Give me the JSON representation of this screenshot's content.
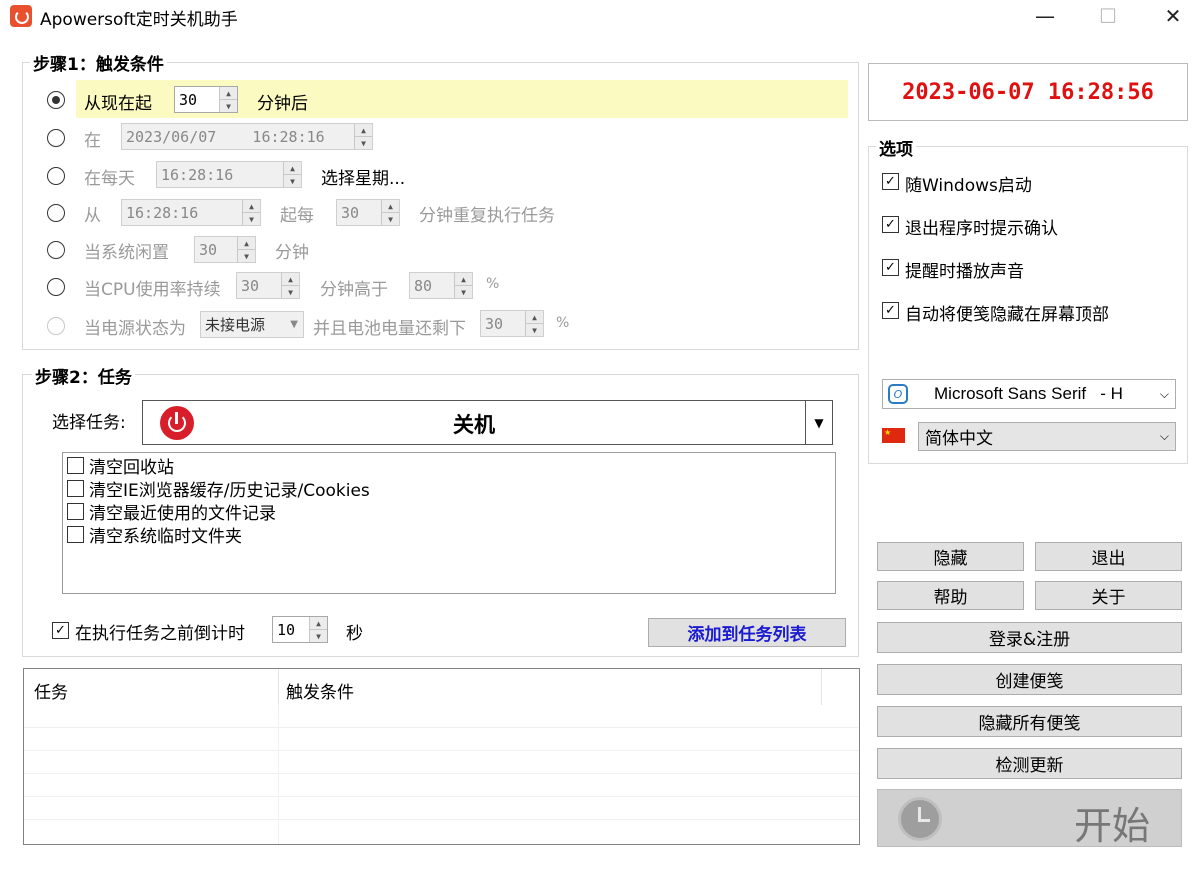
{
  "window": {
    "title": "Apowersoft定时关机助手",
    "minimize": "—",
    "maximize": "☐",
    "close": "✕"
  },
  "step1": {
    "label": "步骤1：触发条件",
    "rows": [
      {
        "label": "从现在起",
        "value": "30",
        "suffix": "分钟后",
        "selected": true
      },
      {
        "label": "在",
        "datetime": "2023/06/07    16:28:16"
      },
      {
        "label": "在每天",
        "time": "16:28:16",
        "suffix": "选择星期..."
      },
      {
        "label": "从",
        "time": "16:28:16",
        "mid": "起每",
        "value": "30",
        "suffix": "分钟重复执行任务"
      },
      {
        "label": "当系统闲置",
        "value": "30",
        "suffix": "分钟"
      },
      {
        "label": "当CPU使用率持续",
        "value": "30",
        "mid": "分钟高于",
        "value2": "80",
        "suffix": "%"
      },
      {
        "label": "当电源状态为",
        "select": "未接电源",
        "mid": "并且电池电量还剩下",
        "value": "30",
        "suffix": "%"
      }
    ]
  },
  "step2": {
    "label": "步骤2：任务",
    "select_label": "选择任务:",
    "task": "关机",
    "options": [
      "清空回收站",
      "清空IE浏览器缓存/历史记录/Cookies",
      "清空最近使用的文件记录",
      "清空系统临时文件夹"
    ],
    "countdown_label": "在执行任务之前倒计时",
    "countdown_value": "10",
    "countdown_unit": "秒",
    "add_button": "添加到任务列表"
  },
  "task_table": {
    "columns": [
      "任务",
      "触发条件"
    ]
  },
  "clock": "2023-06-07  16:28:56",
  "options": {
    "label": "选项",
    "checks": [
      "随Windows启动",
      "退出程序时提示确认",
      "提醒时播放声音",
      "自动将便笺隐藏在屏幕顶部"
    ],
    "font": "Microsoft Sans Serif   - H",
    "language": "简体中文"
  },
  "buttons": {
    "hide": "隐藏",
    "exit": "退出",
    "help": "帮助",
    "about": "关于",
    "login": "登录&注册",
    "create_note": "创建便笺",
    "hide_notes": "隐藏所有便笺",
    "update": "检测更新",
    "start": "开始"
  },
  "colors": {
    "clock": "#e01010",
    "add_button_text": "#1a1ad0",
    "highlight": "#fbfac0"
  }
}
